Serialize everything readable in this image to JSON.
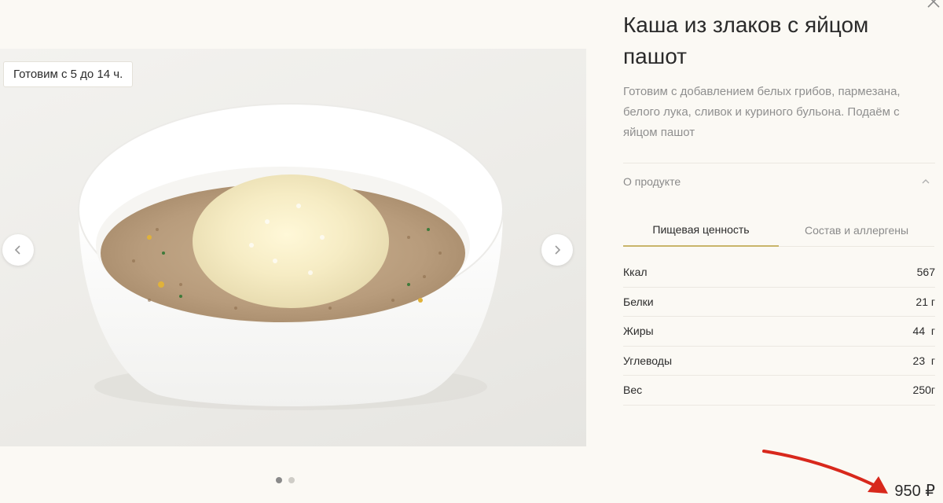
{
  "gallery": {
    "time_badge": "Готовим с 5 до 14 ч.",
    "image_alt": "Каша из злаков с яйцом пашот",
    "slides_total": 2,
    "active_slide": 1
  },
  "product": {
    "title": "Каша из злаков с яйцом пашот",
    "description": "Готовим с добавлением белых грибов, пармезана, белого лука, сливок и куриного бульона. Подаём с яйцом пашот",
    "about_label": "О продукте",
    "tabs": [
      {
        "label": "Пищевая ценность",
        "active": true
      },
      {
        "label": "Состав и аллергены",
        "active": false
      }
    ],
    "nutrition": [
      {
        "name": "Ккал",
        "value": "567"
      },
      {
        "name": "Белки",
        "value": "21 г"
      },
      {
        "name": "Жиры",
        "value": "44  г"
      },
      {
        "name": "Углеводы",
        "value": "23  г"
      },
      {
        "name": "Вес",
        "value": "250г"
      }
    ],
    "price": "950 ₽"
  },
  "icons": {
    "prev": "chevron-left-icon",
    "next": "chevron-right-icon",
    "close": "close-icon",
    "about_toggle": "chevron-up-icon",
    "annotation": "red-arrow-icon"
  },
  "colors": {
    "background": "#fbf9f4",
    "tab_accent": "#c9b56a",
    "annotation_arrow": "#d8281c"
  }
}
